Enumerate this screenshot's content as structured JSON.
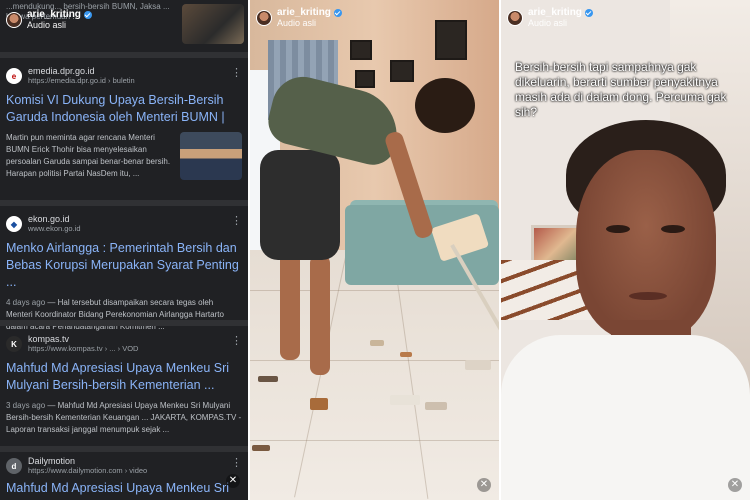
{
  "reel": {
    "username": "arie_kriting",
    "audio": "Audio asli"
  },
  "search": {
    "top_snippet": "...mendukung... bersih-bersih BUMN, Jaksa ... bahwa pertemuan ...",
    "results": [
      {
        "site": "emedia.dpr.go.id",
        "url": "https://emedia.dpr.go.id › buletin",
        "favicon": "e",
        "title": "Komisi VI Dukung Upaya Bersih-Bersih Garuda Indonesia oleh Menteri BUMN |",
        "age": "",
        "snippet": "Martin pun meminta agar rencana Menteri BUMN Erick Thohir bisa menyelesaikan persoalan Garuda sampai benar-benar bersih. Harapan politisi Partai NasDem itu, ..."
      },
      {
        "site": "ekon.go.id",
        "url": "www.ekon.go.id",
        "favicon": "◆",
        "title": "Menko Airlangga : Pemerintah Bersih dan Bebas Korupsi Merupakan Syarat Penting ...",
        "age": "4 days ago",
        "snippet": "— Hal tersebut disampaikan secara tegas oleh Menteri Koordinator Bidang Perekonomian Airlangga Hartarto dalam acara Penandatanganan Komitmen ..."
      },
      {
        "site": "kompas.tv",
        "url": "https://www.kompas.tv › ... › VOD",
        "favicon": "K",
        "title": "Mahfud Md Apresiasi Upaya Menkeu Sri Mulyani Bersih-bersih Kementerian ...",
        "age": "3 days ago",
        "snippet": "— Mahfud Md Apresiasi Upaya Menkeu Sri Mulyani Bersih-bersih Kementerian Keuangan ... JAKARTA, KOMPAS.TV - Laporan transaksi janggal menumpuk sejak ..."
      },
      {
        "site": "Dailymotion",
        "url": "https://www.dailymotion.com › video",
        "favicon": "d",
        "title": "Mahfud Md Apresiasi Upaya Menkeu Sri",
        "age": "",
        "snippet": ""
      }
    ]
  },
  "caption": "Bersih-bersih  tapi sampahnya gak dikeluarin, berarti sumber penyakitnya masih ada di dalam dong. Percuma gak sih?",
  "icons": {
    "mute": "speaker-muted-icon",
    "more": "kebab-menu-icon",
    "verified": "verified-badge-icon"
  }
}
